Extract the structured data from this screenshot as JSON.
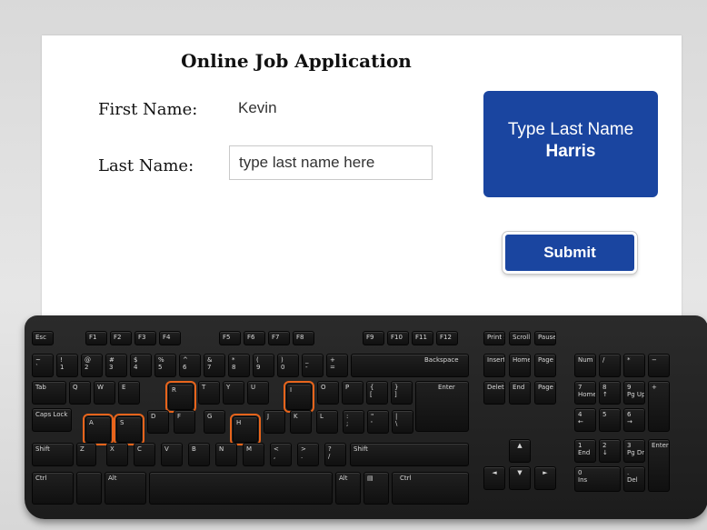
{
  "form": {
    "title": "Online Job Application",
    "first_name_label": "First Name:",
    "first_name_value": "Kevin",
    "last_name_label": "Last Name:",
    "last_name_placeholder": "type last name here"
  },
  "instruction": {
    "line1": "Type Last Name",
    "line2": "Harris"
  },
  "submit_label": "Submit",
  "colors": {
    "accent": "#1a45a0",
    "highlight": "#e8641b"
  },
  "keyboard": {
    "highlighted_keys": [
      "R",
      "I",
      "A",
      "S",
      "H"
    ],
    "keys": {
      "esc": "Esc",
      "f1": "F1",
      "f2": "F2",
      "f3": "F3",
      "f4": "F4",
      "f5": "F5",
      "f6": "F6",
      "f7": "F7",
      "f8": "F8",
      "f9": "F9",
      "f10": "F10",
      "f11": "F11",
      "f12": "F12",
      "prtsc": "Print Screen",
      "scroll": "Scroll Lock",
      "pause": "Pause Break",
      "tilde": "~\n`",
      "n1": "!\n1",
      "n2": "@\n2",
      "n3": "#\n3",
      "n4": "$\n4",
      "n5": "%\n5",
      "n6": "^\n6",
      "n7": "&\n7",
      "n8": "*\n8",
      "n9": "(\n9",
      "n0": ")\n0",
      "minus": "_\n-",
      "equals": "+\n=",
      "backspace": "Backspace",
      "insert": "Insert",
      "home": "Home",
      "pageup": "Page Up",
      "numlock": "Num Lock",
      "npdiv": "/",
      "npmul": "*",
      "npminus": "−",
      "tab": "Tab",
      "q": "Q",
      "w": "W",
      "e": "E",
      "r": "R",
      "t": "T",
      "y": "Y",
      "u": "U",
      "i": "I",
      "o": "O",
      "p": "P",
      "lbracket": "{\n[",
      "rbracket": "}\n]",
      "enter": "Enter",
      "delete": "Delete",
      "end": "End",
      "pagedown": "Page Down",
      "np7": "7\nHome",
      "np8": "8\n↑",
      "np9": "9\nPg Up",
      "npplus": "+",
      "caps": "Caps Lock",
      "a": "A",
      "s": "S",
      "d": "D",
      "f": "F",
      "g": "G",
      "h": "H",
      "j": "J",
      "k": "K",
      "l": "L",
      "semicolon": ":\n;",
      "quote": "\"\n'",
      "backslash": "|\n\\",
      "np4": "4\n←",
      "np5": "5",
      "np6": "6\n→",
      "lshift": "Shift",
      "z": "Z",
      "x": "X",
      "c": "C",
      "v": "V",
      "b": "B",
      "n": "N",
      "m": "M",
      "comma": "<\n,",
      "period": ">\n.",
      "slash": "?\n/",
      "rshift": "Shift",
      "up": "▲",
      "np1": "1\nEnd",
      "np2": "2\n↓",
      "np3": "3\nPg Dn",
      "npenter": "Enter",
      "lctrl": "Ctrl",
      "lalt": "Alt",
      "space": "",
      "ralt": "Alt",
      "menu": "▤",
      "rctrl": "Ctrl",
      "left": "◄",
      "down": "▼",
      "right": "►",
      "np0": "0\nIns",
      "npdot": ".\nDel"
    }
  }
}
